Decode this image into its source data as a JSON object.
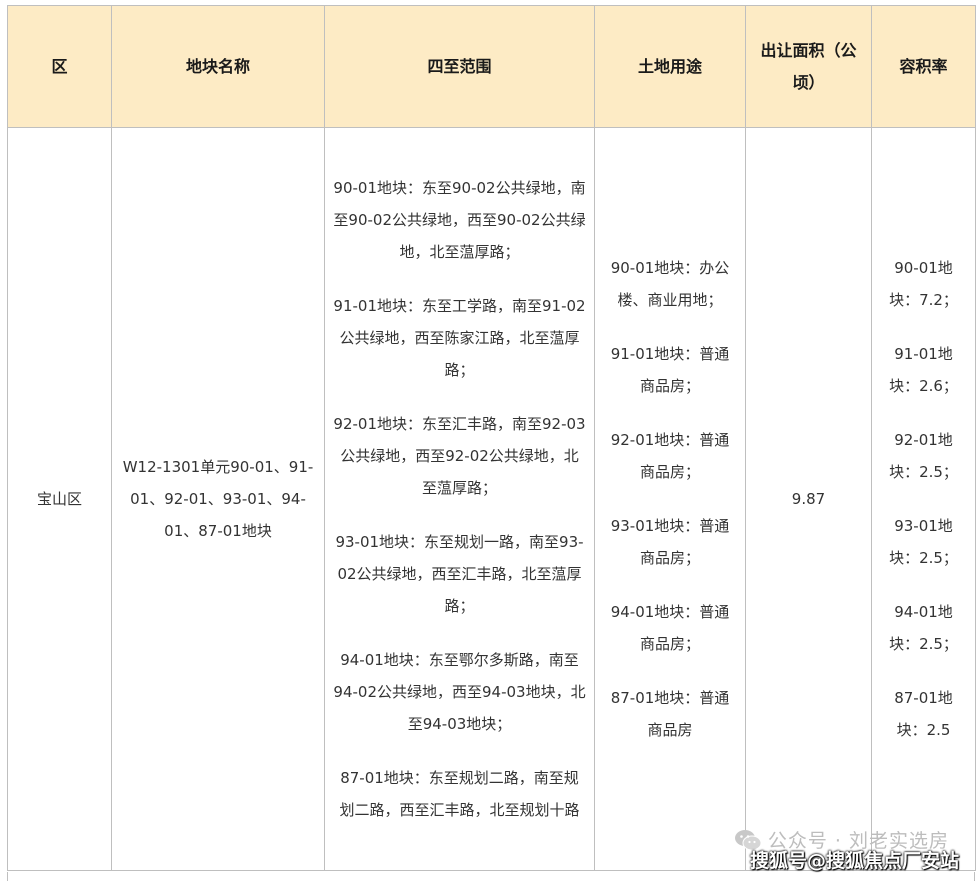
{
  "table": {
    "headers": {
      "district": "区",
      "parcel_name": "地块名称",
      "boundary": "四至范围",
      "land_use": "土地用途",
      "area": "出让面积（公顷）",
      "far": "容积率"
    },
    "row": {
      "district": "宝山区",
      "parcel_name": "W12-1301单元90-01、91-01、92-01、93-01、94-01、87-01地块",
      "boundaries": [
        "90-01地块：东至90-02公共绿地，南至90-02公共绿地，西至90-02公共绿地，北至蕰厚路；",
        "91-01地块：东至工学路，南至91-02公共绿地，西至陈家江路，北至蕰厚路；",
        "92-01地块：东至汇丰路，南至92-03公共绿地，西至92-02公共绿地，北至蕰厚路；",
        "93-01地块：东至规划一路，南至93-02公共绿地，西至汇丰路，北至蕰厚路；",
        "94-01地块：东至鄂尔多斯路，南至94-02公共绿地，西至94-03地块，北至94-03地块；",
        "87-01地块：东至规划二路，南至规划二路，西至汇丰路，北至规划十路"
      ],
      "land_uses": [
        "90-01地块：办公楼、商业用地；",
        "91-01地块：普通商品房；",
        "92-01地块：普通商品房；",
        "93-01地块：普通商品房；",
        "94-01地块：普通商品房；",
        "87-01地块：普通商品房"
      ],
      "area": "9.87",
      "fars": [
        "90-01地块：7.2；",
        "91-01地块：2.6；",
        "92-01地块：2.5；",
        "93-01地块：2.5；",
        "94-01地块：2.5；",
        "87-01地块：2.5"
      ]
    }
  },
  "watermark": {
    "account": "公众号 · 刘老实选房",
    "source": "搜狐号@搜狐焦点厂安站",
    "icon": "wechat-icon"
  },
  "colors": {
    "header_bg": "#fdebc5",
    "border": "#bfbfbf"
  }
}
